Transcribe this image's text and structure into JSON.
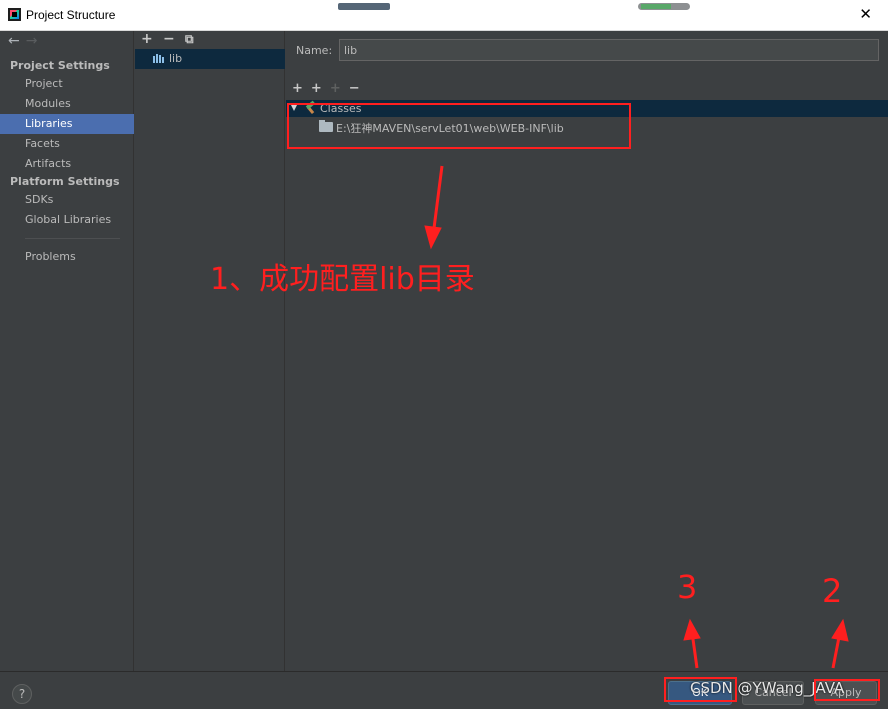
{
  "window": {
    "title": "Project Structure",
    "close_glyph": "✕"
  },
  "nav": {
    "back_glyph": "←",
    "forward_glyph": "→"
  },
  "sidebar": {
    "project_settings_header": "Project Settings",
    "platform_settings_header": "Platform Settings",
    "items": [
      {
        "label": "Project"
      },
      {
        "label": "Modules"
      },
      {
        "label": "Libraries",
        "selected": true
      },
      {
        "label": "Facets"
      },
      {
        "label": "Artifacts"
      },
      {
        "label": "SDKs"
      },
      {
        "label": "Global Libraries"
      },
      {
        "label": "Problems"
      }
    ]
  },
  "library_panel": {
    "add_glyph": "+",
    "remove_glyph": "−",
    "copy_glyph": "⧉",
    "selected_library": "lib",
    "library_icon": "library-icon"
  },
  "detail": {
    "name_label": "Name:",
    "name_value": "lib",
    "toolbar": {
      "add": "+",
      "add_special": "+",
      "add_disabled": "+",
      "remove": "−"
    },
    "tree": {
      "classes_label": "Classes",
      "classes_icon": "hammer-icon",
      "path": "E:\\狂神MAVEN\\servLet01\\web\\WEB-INF\\lib",
      "path_icon": "folder-icon"
    }
  },
  "annotations": {
    "step1": "1、成功配置lib目录",
    "step2": "2",
    "step3": "3",
    "color": "#ff1f1f"
  },
  "footer": {
    "help_glyph": "?",
    "ok_label": "OK",
    "cancel_label": "Cancel",
    "apply_label": "Apply",
    "watermark": "CSDN @YWang_JAVA"
  },
  "colors": {
    "background": "#3c3f41",
    "selection": "#4b6eaf",
    "tree_selection": "#0d293e",
    "ok_button": "#365880"
  }
}
